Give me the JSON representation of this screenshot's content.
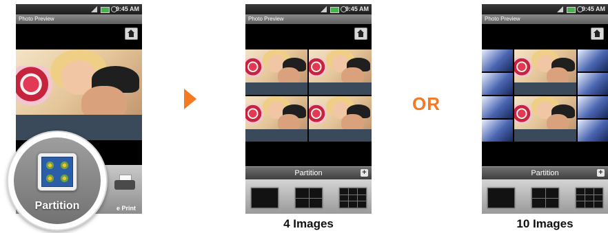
{
  "status_bar": {
    "time": "9:45 AM"
  },
  "screen_title": "Photo Preview",
  "partition_panel": {
    "title": "Partition"
  },
  "toolbar": {
    "partition_label": "Partition",
    "print_label": "Print",
    "partial_label": "e"
  },
  "transition": {
    "arrow": "play-arrow-icon",
    "or_label": "OR"
  },
  "captions": {
    "four": "4 Images",
    "ten": "10 Images"
  },
  "colors": {
    "accent": "#f47920"
  }
}
